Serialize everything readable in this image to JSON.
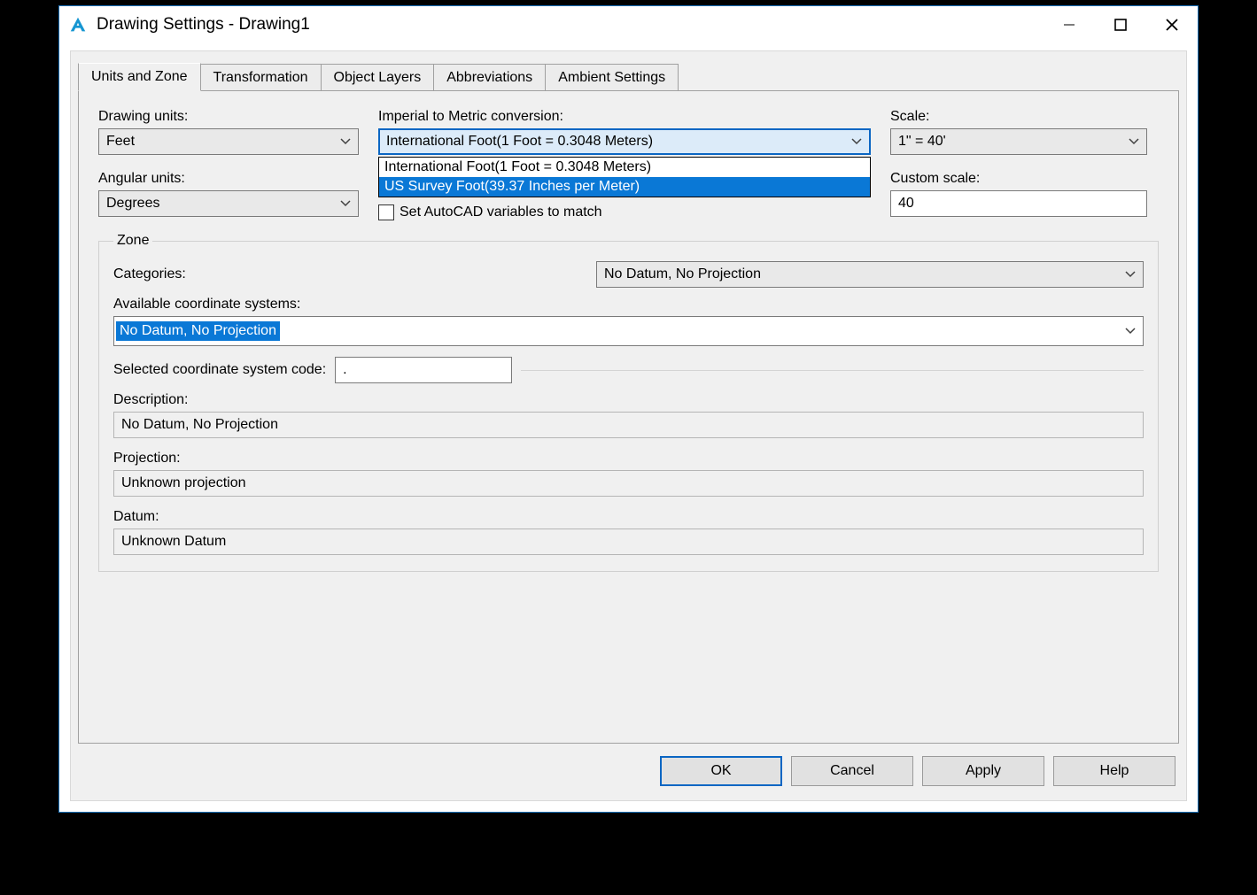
{
  "window": {
    "title": "Drawing Settings - Drawing1"
  },
  "tabs": [
    "Units and Zone",
    "Transformation",
    "Object Layers",
    "Abbreviations",
    "Ambient Settings"
  ],
  "labels": {
    "drawing_units": "Drawing units:",
    "imperial_conversion": "Imperial to Metric conversion:",
    "scale": "Scale:",
    "angular_units": "Angular units:",
    "custom_scale": "Custom scale:",
    "set_vars": "Set AutoCAD variables to match",
    "zone_legend": "Zone",
    "categories": "Categories:",
    "available": "Available coordinate systems:",
    "selected_code": "Selected coordinate system code:",
    "description": "Description:",
    "projection": "Projection:",
    "datum": "Datum:"
  },
  "values": {
    "drawing_units": "Feet",
    "imperial_conversion": "International Foot(1 Foot = 0.3048 Meters)",
    "scale": "1\" = 40'",
    "angular_units": "Degrees",
    "custom_scale": "40",
    "categories": "No Datum, No Projection",
    "available": "No Datum, No Projection",
    "selected_code": ".",
    "description": "No Datum, No Projection",
    "projection": "Unknown projection",
    "datum": "Unknown Datum"
  },
  "dropdown_options": {
    "imperial_conversion": [
      "International Foot(1 Foot = 0.3048 Meters)",
      "US Survey Foot(39.37 Inches per Meter)"
    ]
  },
  "buttons": {
    "ok": "OK",
    "cancel": "Cancel",
    "apply": "Apply",
    "help": "Help"
  }
}
